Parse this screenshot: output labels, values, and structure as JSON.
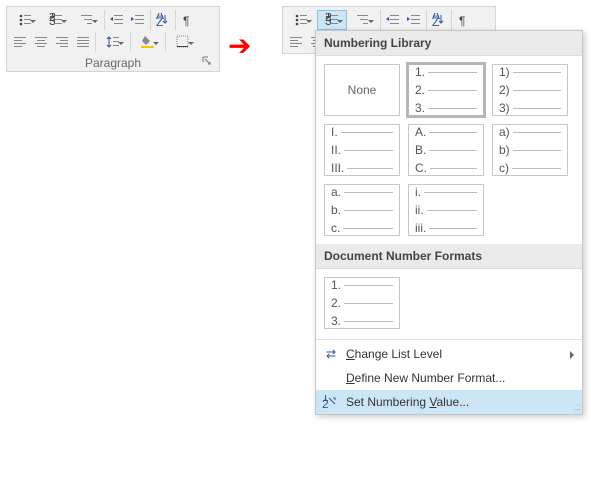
{
  "group_label": "Paragraph",
  "arrow_glyph": "➔",
  "dropdown": {
    "library_header": "Numbering Library",
    "doc_formats_header": "Document Number Formats",
    "none_label": "None",
    "thumbs": {
      "decimal_dot": [
        "1.",
        "2.",
        "3."
      ],
      "decimal_paren": [
        "1)",
        "2)",
        "3)"
      ],
      "roman_upper": [
        "I.",
        "II.",
        "III."
      ],
      "alpha_upper": [
        "A.",
        "B.",
        "C."
      ],
      "alpha_lower_paren": [
        "a)",
        "b)",
        "c)"
      ],
      "alpha_lower_dot": [
        "a.",
        "b.",
        "c."
      ],
      "roman_lower": [
        "i.",
        "ii.",
        "iii."
      ]
    },
    "doc_thumb": [
      "1.",
      "2.",
      "3."
    ],
    "menu": {
      "change_level": {
        "pre": "",
        "u": "C",
        "post": "hange List Level"
      },
      "define_format": {
        "pre": "",
        "u": "D",
        "post": "efine New Number Format..."
      },
      "set_value": {
        "pre": "Set Numbering ",
        "u": "V",
        "post": "alue..."
      }
    }
  }
}
